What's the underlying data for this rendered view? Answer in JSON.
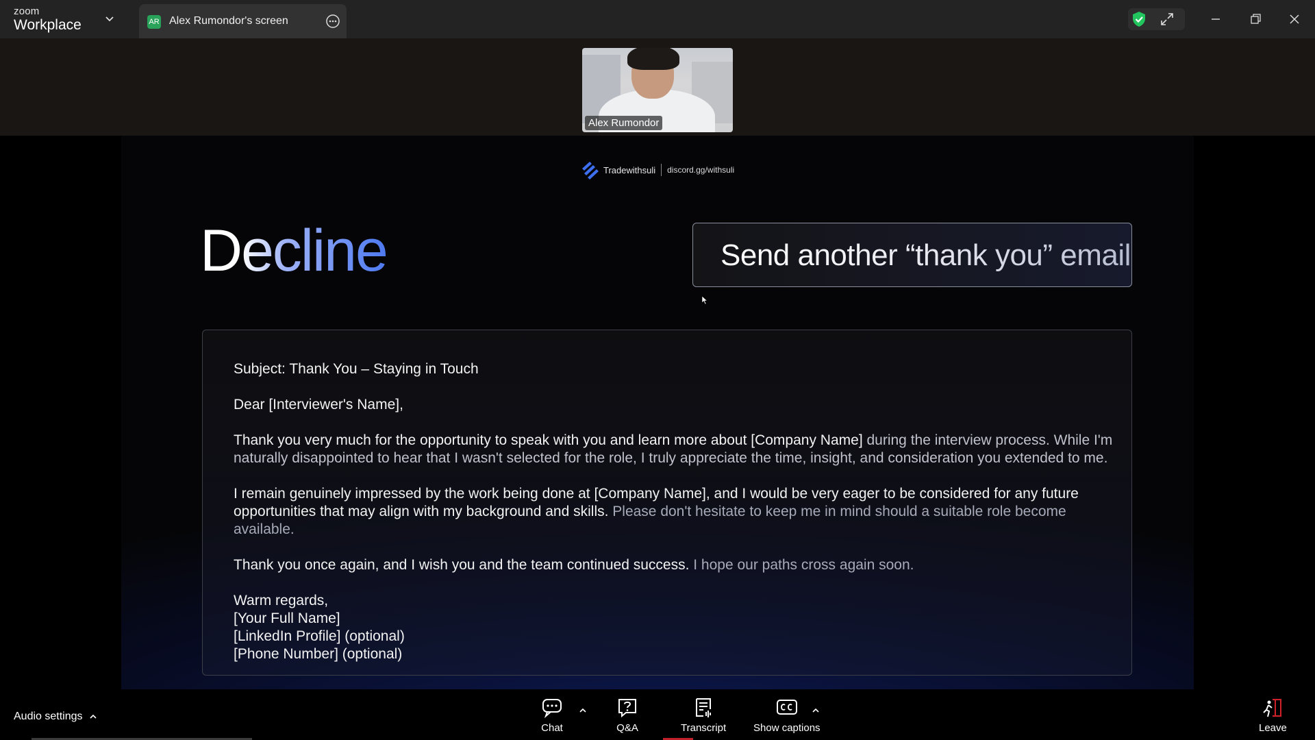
{
  "window": {
    "brand_small": "zoom",
    "brand_large": "Workplace",
    "tab_avatar": "AR",
    "tab_title": "Alex Rumondor's screen",
    "icons": [
      "chevron-down-icon",
      "more-options-icon",
      "shield-check-icon",
      "expand-icon",
      "minimize-icon",
      "restore-icon",
      "close-icon"
    ]
  },
  "participant": {
    "name": "Alex Rumondor"
  },
  "slide": {
    "brand": "Tradewithsuli",
    "discord": "discord.gg/withsuli",
    "title": "Decline",
    "cta": "Send another “thank you” email",
    "email": {
      "subject": "Subject: Thank You – Staying in Touch",
      "greeting": "Dear [Interviewer's Name],",
      "p1_a": "Thank you very much for the opportunity to speak with you and learn more about [Company Name] ",
      "p1_b": "during the interview process. While I'm naturally disappointed to hear that I wasn't selected for the role, I truly appreciate the time, insight, and consideration you extended to me.",
      "p2_a": "I remain genuinely impressed by the work being done at [Company Name], and I would be very eager to be considered for any future opportunities that may align with my background and skills. ",
      "p2_b": "Please don't hesitate to keep me in mind should a suitable role become available.",
      "p3_a": "Thank you once again, and I wish you and the team continued success. ",
      "p3_b": "I hope our paths cross again soon.",
      "closing": "Warm regards,",
      "sig1": "[Your Full Name]",
      "sig2": "[LinkedIn Profile] (optional)",
      "sig3": "[Phone Number] (optional)"
    }
  },
  "toolbar": {
    "audio_settings": "Audio settings",
    "chat": "Chat",
    "qa": "Q&A",
    "transcript": "Transcript",
    "captions": "Show captions",
    "leave": "Leave"
  },
  "colors": {
    "accent_blue": "#4d79f0",
    "shield_green": "#23c55e",
    "leave_red": "#d0202a"
  }
}
